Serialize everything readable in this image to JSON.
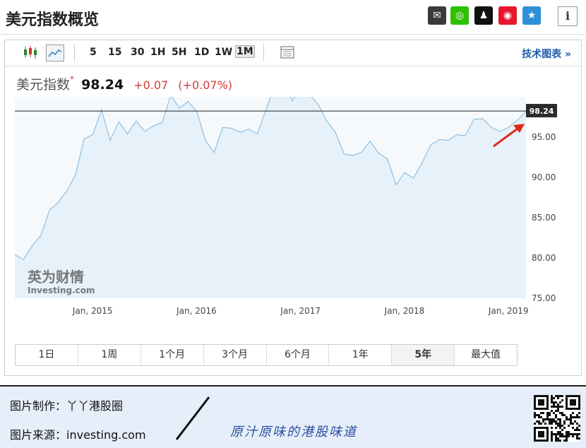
{
  "header": {
    "title": "美元指数概览",
    "share_icons": [
      {
        "name": "email-icon",
        "glyph": "✉",
        "color": "#3a3a3a"
      },
      {
        "name": "wechat-icon",
        "glyph": "◎",
        "color": "#2dc100"
      },
      {
        "name": "qq-icon",
        "glyph": "♟",
        "color": "#111111"
      },
      {
        "name": "weibo-icon",
        "glyph": "◉",
        "color": "#e6162d"
      },
      {
        "name": "qzone-icon",
        "glyph": "★",
        "color": "#2f8fd8"
      }
    ],
    "info_label": "i"
  },
  "toolbar": {
    "intervals": [
      "5",
      "15",
      "30",
      "1H",
      "5H",
      "1D",
      "1W",
      "1M"
    ],
    "active_interval": "1M",
    "tech_chart_label": "技术图表 »"
  },
  "quote": {
    "name": "美元指数",
    "star": "*",
    "price": "98.24",
    "change": "+0.07",
    "change_pct": "(+0.07%)"
  },
  "watermark": {
    "text": "港股圈",
    "logo": "丫丫",
    "investing_cn": "英为财情",
    "investing_en": "Investing.com"
  },
  "chart_data": {
    "type": "area",
    "x_start": "2014-05",
    "x_step": "1 month",
    "x": [
      "2014-05",
      "2014-06",
      "2014-07",
      "2014-08",
      "2014-09",
      "2014-10",
      "2014-11",
      "2014-12",
      "2015-01",
      "2015-02",
      "2015-03",
      "2015-04",
      "2015-05",
      "2015-06",
      "2015-07",
      "2015-08",
      "2015-09",
      "2015-10",
      "2015-11",
      "2015-12",
      "2016-01",
      "2016-02",
      "2016-03",
      "2016-04",
      "2016-05",
      "2016-06",
      "2016-07",
      "2016-08",
      "2016-09",
      "2016-10",
      "2016-11",
      "2016-12",
      "2017-01",
      "2017-02",
      "2017-03",
      "2017-04",
      "2017-05",
      "2017-06",
      "2017-07",
      "2017-08",
      "2017-09",
      "2017-10",
      "2017-11",
      "2017-12",
      "2018-01",
      "2018-02",
      "2018-03",
      "2018-04",
      "2018-05",
      "2018-06",
      "2018-07",
      "2018-08",
      "2018-09",
      "2018-10",
      "2018-11",
      "2018-12",
      "2019-01",
      "2019-02",
      "2019-03",
      "2019-04"
    ],
    "values": [
      80.4,
      79.8,
      81.5,
      82.8,
      85.9,
      86.9,
      88.3,
      90.3,
      94.8,
      95.3,
      98.4,
      94.6,
      96.9,
      95.4,
      97.0,
      95.7,
      96.4,
      96.8,
      100.2,
      98.6,
      99.4,
      98.2,
      94.6,
      93.1,
      96.2,
      96.1,
      95.6,
      96.0,
      95.4,
      98.4,
      101.5,
      102.2,
      99.5,
      101.0,
      100.3,
      99.1,
      97.0,
      95.6,
      92.9,
      92.7,
      93.1,
      94.5,
      93.0,
      92.3,
      89.1,
      90.6,
      89.9,
      91.8,
      94.0,
      94.7,
      94.6,
      95.3,
      95.2,
      97.2,
      97.3,
      96.2,
      95.7,
      96.2,
      97.1,
      98.24
    ],
    "last_value": 98.24,
    "last_label": "98.24",
    "ylim": [
      75,
      100
    ],
    "y_ticks": [
      75,
      80,
      85,
      90,
      95
    ],
    "y_tick_labels": [
      "75.00",
      "80.00",
      "85.00",
      "90.00",
      "95.00"
    ],
    "x_tick_labels": [
      {
        "label": "Jan, 2015",
        "at": "2015-01"
      },
      {
        "label": "Jan, 2016",
        "at": "2016-01"
      },
      {
        "label": "Jan, 2017",
        "at": "2017-01"
      },
      {
        "label": "Jan, 2018",
        "at": "2018-01"
      },
      {
        "label": "Jan, 2019",
        "at": "2019-01"
      }
    ],
    "line_color": "#8fbfe0",
    "fill_color": "#e6f1fa",
    "reference_line_color": "#222222",
    "arrow_color": "#e0271a",
    "grid": false,
    "title": "",
    "xlabel": "",
    "ylabel": ""
  },
  "range_tabs": [
    "1日",
    "1周",
    "1个月",
    "3个月",
    "6个月",
    "1年",
    "5年",
    "最大值"
  ],
  "active_range": "5年",
  "footer": {
    "maker_label": "图片制作：",
    "maker_value": "丫丫港股圈",
    "source_label": "图片来源：",
    "source_value": "investing.com",
    "slogan": "原汁原味的港股味道"
  }
}
